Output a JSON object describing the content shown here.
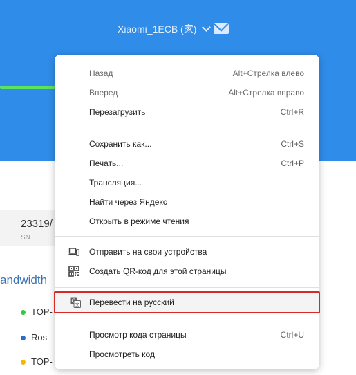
{
  "router": {
    "name": "Xiaomi_1ECB (家)",
    "sn_value": "23319/",
    "sn_label": "SN",
    "bandwidth_title": "andwidth"
  },
  "devices": [
    {
      "name": "TOP-",
      "dot_color": "#2ecc40"
    },
    {
      "name": "Ros",
      "dot_color": "#2b6fc2"
    },
    {
      "name": "TOP-",
      "dot_color": "#f5b800"
    }
  ],
  "colors": {
    "topbar": "#2f8ce9",
    "highlight_border": "#d62a2a",
    "progress": "#5de35d"
  },
  "menu": {
    "back": {
      "label": "Назад",
      "shortcut": "Alt+Стрелка влево"
    },
    "forward": {
      "label": "Вперед",
      "shortcut": "Alt+Стрелка вправо"
    },
    "reload": {
      "label": "Перезагрузить",
      "shortcut": "Ctrl+R"
    },
    "save_as": {
      "label": "Сохранить как...",
      "shortcut": "Ctrl+S"
    },
    "print": {
      "label": "Печать...",
      "shortcut": "Ctrl+P"
    },
    "cast": {
      "label": "Трансляция..."
    },
    "search_yandex": {
      "label": "Найти через Яндекс"
    },
    "reading_mode": {
      "label": "Открыть в режиме чтения"
    },
    "send_to_devices": {
      "label": "Отправить на свои устройства",
      "icon": "devices-icon"
    },
    "qr_code": {
      "label": "Создать QR-код для этой страницы",
      "icon": "qr-code-icon"
    },
    "translate": {
      "label": "Перевести на русский",
      "icon": "translate-icon"
    },
    "view_source": {
      "label": "Просмотр кода страницы",
      "shortcut": "Ctrl+U"
    },
    "inspect": {
      "label": "Просмотреть код"
    }
  }
}
